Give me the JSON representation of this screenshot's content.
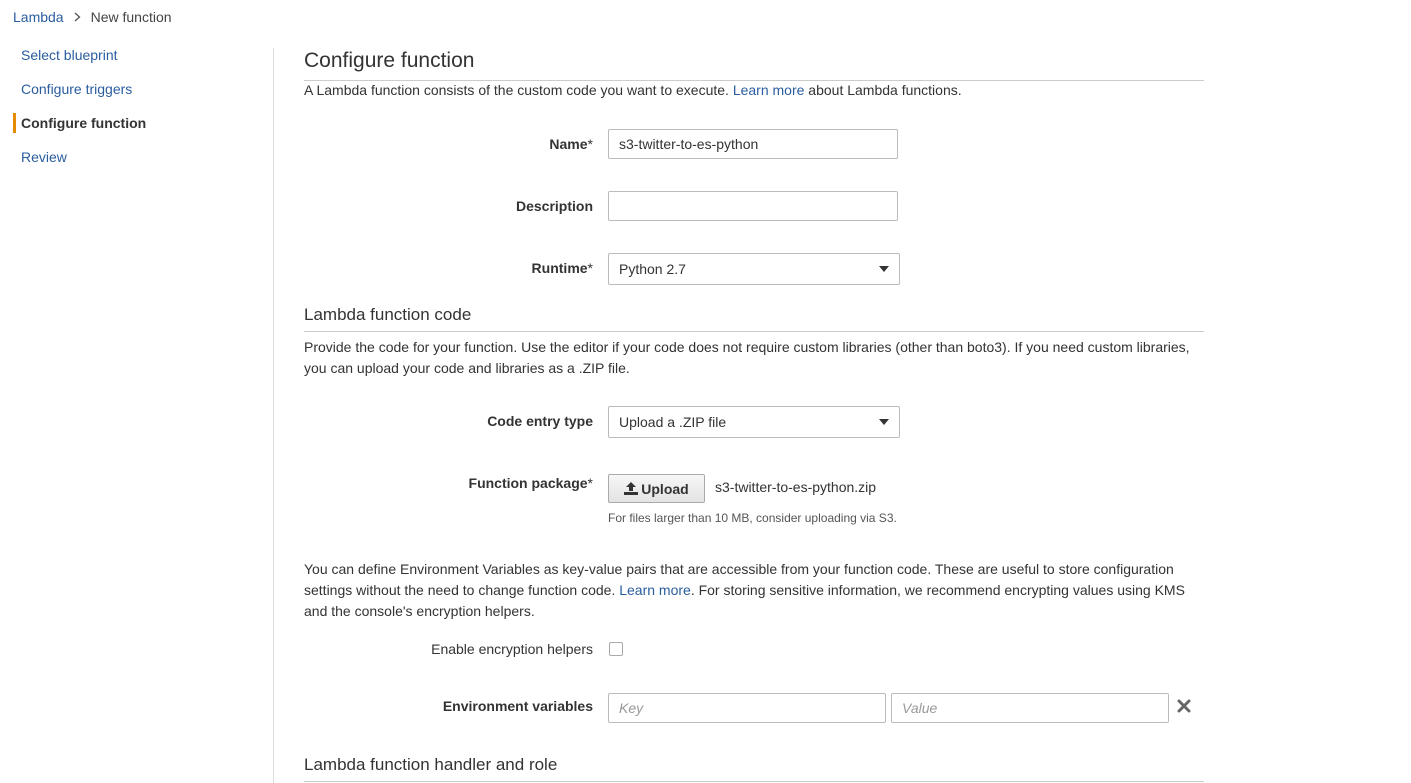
{
  "breadcrumb": {
    "root": "Lambda",
    "current": "New function"
  },
  "sidebar": {
    "items": [
      {
        "label": "Select blueprint"
      },
      {
        "label": "Configure triggers"
      },
      {
        "label": "Configure function"
      },
      {
        "label": "Review"
      }
    ],
    "active": "Configure function"
  },
  "configure": {
    "title": "Configure function",
    "intro_before": "A Lambda function consists of the custom code you want to execute. ",
    "intro_link": "Learn more",
    "intro_after": " about Lambda functions.",
    "name_label": "Name",
    "name_value": "s3-twitter-to-es-python",
    "description_label": "Description",
    "description_value": "",
    "runtime_label": "Runtime",
    "runtime_value": "Python 2.7",
    "required_mark": "*"
  },
  "code": {
    "title": "Lambda function code",
    "intro": "Provide the code for your function. Use the editor if your code does not require custom libraries (other than boto3). If you need custom libraries, you can upload your code and libraries as a .ZIP file.",
    "entry_type_label": "Code entry type",
    "entry_type_value": "Upload a .ZIP file",
    "package_label": "Function package",
    "upload_label": "Upload",
    "file_name": "s3-twitter-to-es-python.zip",
    "hint": "For files larger than 10 MB, consider uploading via S3."
  },
  "env": {
    "intro_before": "You can define Environment Variables as key-value pairs that are accessible from your function code. These are useful to store configuration settings without the need to change function code. ",
    "intro_link": "Learn more",
    "intro_after": ". For storing sensitive information, we recommend encrypting values using KMS and the console's encryption helpers.",
    "encryption_label": "Enable encryption helpers",
    "encryption_checked": false,
    "variables_label": "Environment variables",
    "key_placeholder": "Key",
    "value_placeholder": "Value"
  },
  "handler": {
    "title": "Lambda function handler and role"
  },
  "colors": {
    "link": "#2a5d9f",
    "accent": "#e68a00",
    "text": "#333333",
    "border": "#bbbbbb"
  },
  "icons": {
    "breadcrumb_sep": "chevron-right-icon",
    "upload": "upload-icon",
    "remove": "close-icon",
    "select": "caret-down-icon"
  }
}
